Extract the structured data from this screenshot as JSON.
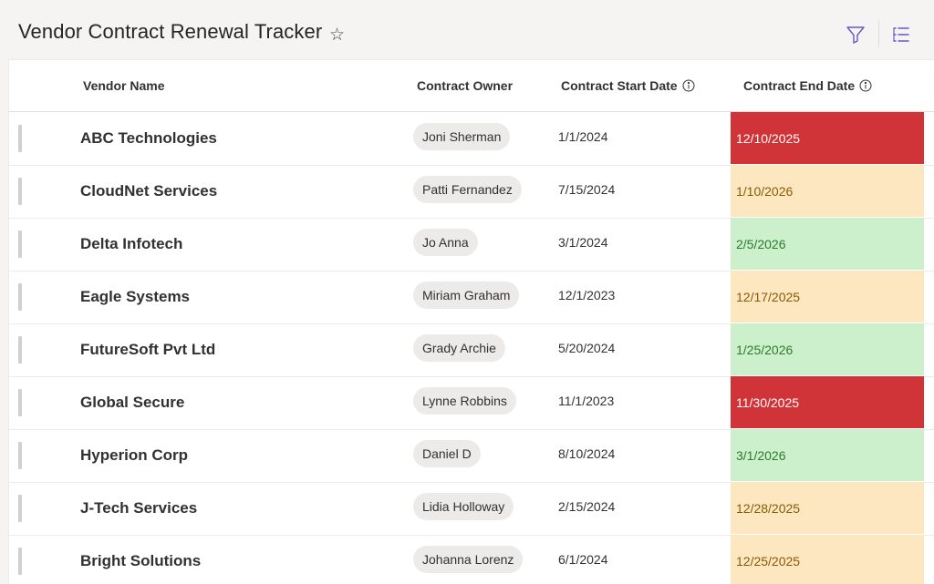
{
  "header": {
    "title": "Vendor Contract Renewal Tracker",
    "favorite_icon": "star-outline-icon",
    "filter_icon": "filter-icon",
    "view_icon": "list-view-icon"
  },
  "table": {
    "columns": [
      {
        "label": "Vendor Name",
        "info": false
      },
      {
        "label": "Contract Owner",
        "info": false
      },
      {
        "label": "Contract Start Date",
        "info": true
      },
      {
        "label": "Contract End Date",
        "info": true
      }
    ],
    "rows": [
      {
        "vendor": "ABC Technologies",
        "owner": "Joni Sherman",
        "start": "1/1/2024",
        "end": "12/10/2025",
        "status": "red"
      },
      {
        "vendor": "CloudNet Services",
        "owner": "Patti Fernandez",
        "start": "7/15/2024",
        "end": "1/10/2026",
        "status": "amber"
      },
      {
        "vendor": "Delta Infotech",
        "owner": "Jo Anna",
        "start": "3/1/2024",
        "end": "2/5/2026",
        "status": "green"
      },
      {
        "vendor": "Eagle Systems",
        "owner": "Miriam Graham",
        "start": "12/1/2023",
        "end": "12/17/2025",
        "status": "amber"
      },
      {
        "vendor": "FutureSoft Pvt Ltd",
        "owner": "Grady Archie",
        "start": "5/20/2024",
        "end": "1/25/2026",
        "status": "green"
      },
      {
        "vendor": "Global Secure",
        "owner": "Lynne Robbins",
        "start": "11/1/2023",
        "end": "11/30/2025",
        "status": "red"
      },
      {
        "vendor": "Hyperion Corp",
        "owner": "Daniel D",
        "start": "8/10/2024",
        "end": "3/1/2026",
        "status": "green"
      },
      {
        "vendor": "J-Tech Services",
        "owner": "Lidia Holloway",
        "start": "2/15/2024",
        "end": "12/28/2025",
        "status": "amber"
      },
      {
        "vendor": "Bright Solutions",
        "owner": "Johanna Lorenz",
        "start": "6/1/2024",
        "end": "12/25/2025",
        "status": "amber"
      }
    ]
  },
  "status_colors": {
    "red": {
      "bg": "#d13438",
      "fg": "#ffffff"
    },
    "amber": {
      "bg": "#fde7c1",
      "fg": "#8a5a00"
    },
    "green": {
      "bg": "#ccf0cc",
      "fg": "#2d7a2d"
    }
  }
}
